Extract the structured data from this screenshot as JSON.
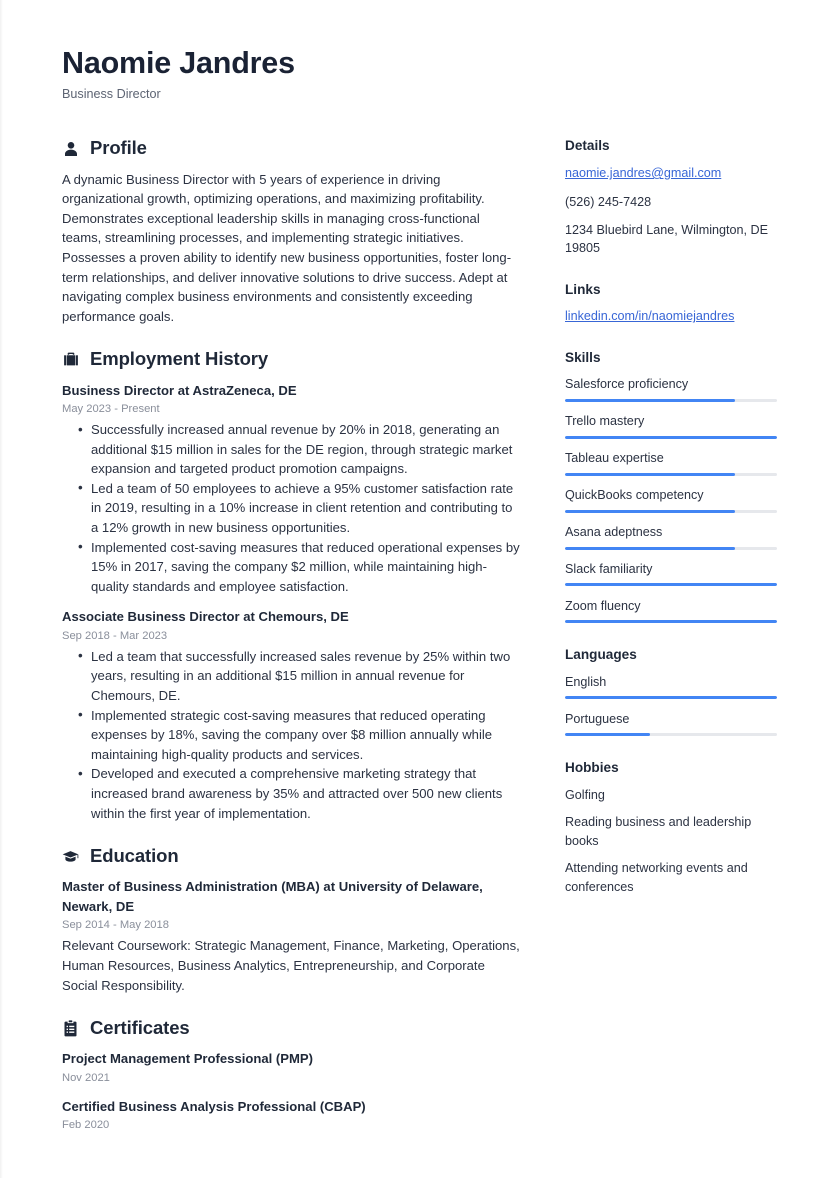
{
  "header": {
    "name": "Naomie Jandres",
    "job_title": "Business Director"
  },
  "accent_color": "#4285f4",
  "link_color": "#3866d6",
  "track_color": "#e6e8ec",
  "main": {
    "profile": {
      "icon": "user-icon",
      "title": "Profile",
      "text": "A dynamic Business Director with 5 years of experience in driving organizational growth, optimizing operations, and maximizing profitability. Demonstrates exceptional leadership skills in managing cross-functional teams, streamlining processes, and implementing strategic initiatives. Possesses a proven ability to identify new business opportunities, foster long-term relationships, and deliver innovative solutions to drive success. Adept at navigating complex business environments and consistently exceeding performance goals."
    },
    "employment": {
      "icon": "briefcase-icon",
      "title": "Employment History",
      "entries": [
        {
          "title": "Business Director at AstraZeneca, DE",
          "date": "May 2023 - Present",
          "bullets": [
            "Successfully increased annual revenue by 20% in 2018, generating an additional $15 million in sales for the DE region, through strategic market expansion and targeted product promotion campaigns.",
            "Led a team of 50 employees to achieve a 95% customer satisfaction rate in 2019, resulting in a 10% increase in client retention and contributing to a 12% growth in new business opportunities.",
            "Implemented cost-saving measures that reduced operational expenses by 15% in 2017, saving the company $2 million, while maintaining high-quality standards and employee satisfaction."
          ]
        },
        {
          "title": "Associate Business Director at Chemours, DE",
          "date": "Sep 2018 - Mar 2023",
          "bullets": [
            "Led a team that successfully increased sales revenue by 25% within two years, resulting in an additional $15 million in annual revenue for Chemours, DE.",
            "Implemented strategic cost-saving measures that reduced operating expenses by 18%, saving the company over $8 million annually while maintaining high-quality products and services.",
            "Developed and executed a comprehensive marketing strategy that increased brand awareness by 35% and attracted over 500 new clients within the first year of implementation."
          ]
        }
      ]
    },
    "education": {
      "icon": "graduation-cap-icon",
      "title": "Education",
      "entries": [
        {
          "title": "Master of Business Administration (MBA) at University of Delaware, Newark, DE",
          "date": "Sep 2014 - May 2018",
          "description": "Relevant Coursework: Strategic Management, Finance, Marketing, Operations, Human Resources, Business Analytics, Entrepreneurship, and Corporate Social Responsibility."
        }
      ]
    },
    "certificates": {
      "icon": "certificate-clipboard-icon",
      "title": "Certificates",
      "entries": [
        {
          "title": "Project Management Professional (PMP)",
          "date": "Nov 2021"
        },
        {
          "title": "Certified Business Analysis Professional (CBAP)",
          "date": "Feb 2020"
        }
      ]
    }
  },
  "sidebar": {
    "details": {
      "title": "Details",
      "email": "naomie.jandres@gmail.com",
      "phone": "(526) 245-7428",
      "address": "1234 Bluebird Lane, Wilmington, DE 19805"
    },
    "links": {
      "title": "Links",
      "items": [
        {
          "label": "linkedin.com/in/naomiejandres"
        }
      ]
    },
    "skills": {
      "title": "Skills",
      "items": [
        {
          "label": "Salesforce proficiency",
          "level": 80
        },
        {
          "label": "Trello mastery",
          "level": 100
        },
        {
          "label": "Tableau expertise",
          "level": 80
        },
        {
          "label": "QuickBooks competency",
          "level": 80
        },
        {
          "label": "Asana adeptness",
          "level": 80
        },
        {
          "label": "Slack familiarity",
          "level": 100
        },
        {
          "label": "Zoom fluency",
          "level": 100
        }
      ]
    },
    "languages": {
      "title": "Languages",
      "items": [
        {
          "label": "English",
          "level": 100
        },
        {
          "label": "Portuguese",
          "level": 40
        }
      ]
    },
    "hobbies": {
      "title": "Hobbies",
      "items": [
        {
          "label": "Golfing"
        },
        {
          "label": "Reading business and leadership books"
        },
        {
          "label": "Attending networking events and conferences"
        }
      ]
    }
  }
}
